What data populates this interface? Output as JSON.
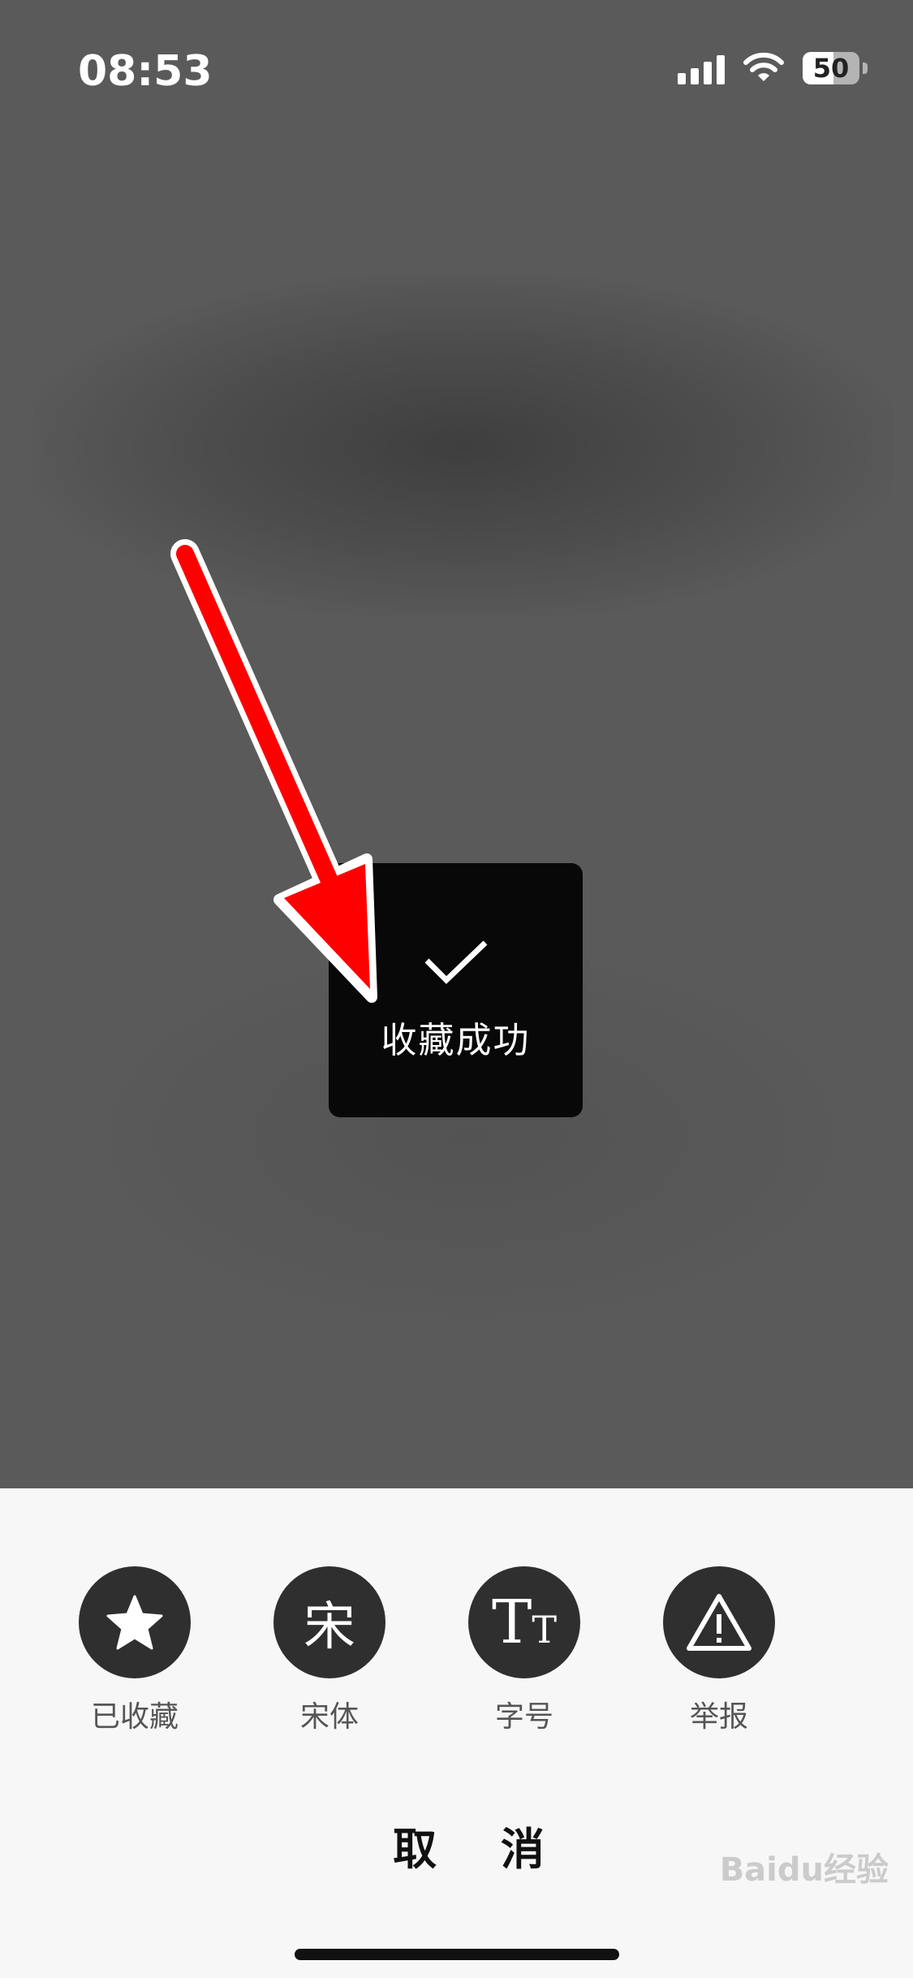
{
  "status_bar": {
    "time": "08:53",
    "battery_level": "50",
    "icons": [
      "signal-icon",
      "wifi-icon",
      "battery-icon"
    ]
  },
  "toast": {
    "icon": "check-icon",
    "message": "收藏成功"
  },
  "annotation": {
    "icon": "red-arrow-icon",
    "color": "#ff0000"
  },
  "action_sheet": {
    "actions": [
      {
        "icon": "star-icon",
        "label": "已收藏"
      },
      {
        "icon": "font-song-icon",
        "glyph": "宋",
        "label": "宋体"
      },
      {
        "icon": "font-size-icon",
        "glyph_big": "T",
        "glyph_small": "T",
        "label": "字号"
      },
      {
        "icon": "warning-icon",
        "label": "举报"
      }
    ],
    "cancel_label": "取 消"
  },
  "watermark": "Baidu经验"
}
